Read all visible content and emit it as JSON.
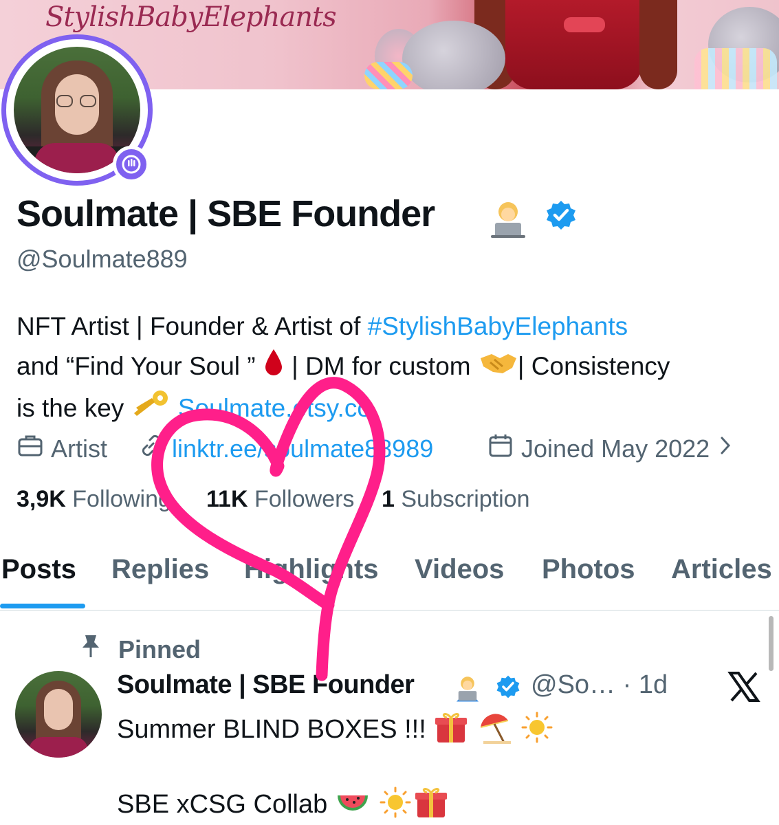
{
  "banner": {
    "title": "StylishBabyElephants"
  },
  "profile": {
    "display_name": "Soulmate | SBE Founder",
    "name_emoji": "technologist-emoji",
    "verified_icon": "verified-badge-icon",
    "handle": "@Soulmate889",
    "spaces_badge_icon": "spaces-icon"
  },
  "bio": {
    "part1": "NFT Artist | Founder & Artist of ",
    "hashtag": "#StylishBabyElephants",
    "part2": "and “Find Your Soul ” ",
    "part3": " | DM for custom ",
    "part4": "| Consistency",
    "part5": "is the key ",
    "link": "Soulmate.etsy.co"
  },
  "meta": {
    "category": "Artist",
    "website": "linktr.ee/soulmate88989",
    "joined": "Joined May 2022"
  },
  "counts": {
    "following_value": "3,9K",
    "following_label": "Following",
    "followers_value": "11K",
    "followers_label": "Followers",
    "subscriptions_value": "1",
    "subscriptions_label": "Subscription"
  },
  "tabs": [
    {
      "label": "Posts",
      "active": true
    },
    {
      "label": "Replies"
    },
    {
      "label": "Highlights"
    },
    {
      "label": "Videos"
    },
    {
      "label": "Photos"
    },
    {
      "label": "Articles"
    }
  ],
  "post": {
    "pinned_label": "Pinned",
    "author": "Soulmate | SBE Founder",
    "handle_time": "@So… · 1d",
    "text_line1": "Summer BLIND BOXES !!! ",
    "text_line2": "SBE xCSG Collab "
  },
  "colors": {
    "accent": "#1d9bf0",
    "spaces_purple": "#7f61f0",
    "heart_pink": "#ff1f8a",
    "muted": "#536471"
  }
}
